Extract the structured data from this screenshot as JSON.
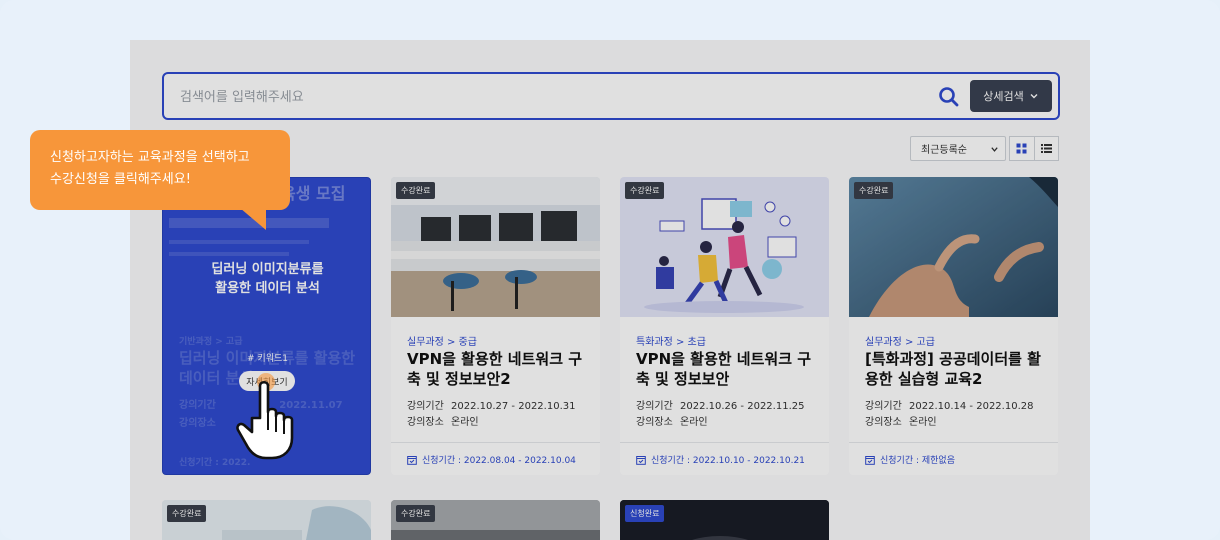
{
  "search": {
    "placeholder": "검색어를 입력해주세요",
    "advanced_label": "상세검색"
  },
  "toolbar": {
    "sort_selected": "최근등록순"
  },
  "tooltip": {
    "line1": "신청하고자하는 교육과정을 선택하고",
    "line2": "수강신청을 클릭해주세요!"
  },
  "featured": {
    "banner_text": "육생 모집",
    "title_line1": "딥러닝 이미지분류를",
    "title_line2": "활용한 데이터 분석",
    "keyword": "# 키워드1",
    "detail_label": "자세히보기",
    "ghost_category": "기반과정 > 고급",
    "ghost_title_line1": "딥러닝 이미지분류를 활용한",
    "ghost_title_line2": "데이터 분석",
    "ghost_period_key": "강의기간",
    "ghost_period_value": "2022.11.07",
    "ghost_place_key": "강의장소",
    "ghost_apply": "신청기간 : 2022."
  },
  "cards": [
    {
      "badge": "수강완료",
      "category": "실무과정 > 중급",
      "title": "VPN을 활용한 네트워크 구축 및 정보보안2",
      "period_key": "강의기간",
      "period_value": "2022.10.27 - 2022.10.31",
      "place_key": "강의장소",
      "place_value": "온라인",
      "apply": "신청기간 : 2022.08.04 - 2022.10.04"
    },
    {
      "badge": "수강완료",
      "category": "특화과정 > 초급",
      "title": "VPN을 활용한 네트워크 구축 및 정보보안",
      "period_key": "강의기간",
      "period_value": "2022.10.26 - 2022.11.25",
      "place_key": "강의장소",
      "place_value": "온라인",
      "apply": "신청기간 : 2022.10.10 - 2022.10.21"
    },
    {
      "badge": "수강완료",
      "category": "실무과정 > 고급",
      "title": "[특화과정] 공공데이터를 활용한 실습형 교육2",
      "period_key": "강의기간",
      "period_value": "2022.10.14 - 2022.10.28",
      "place_key": "강의장소",
      "place_value": "온라인",
      "apply": "신청기간 : 제한없음"
    }
  ],
  "bottom_cards": [
    {
      "badge": "수강완료"
    },
    {
      "badge": "수강완료"
    },
    {
      "badge": "신청완료"
    }
  ],
  "colors": {
    "primary": "#2f4bd0",
    "tooltip": "#f7963a",
    "badge_dark": "#3a3f4a"
  }
}
